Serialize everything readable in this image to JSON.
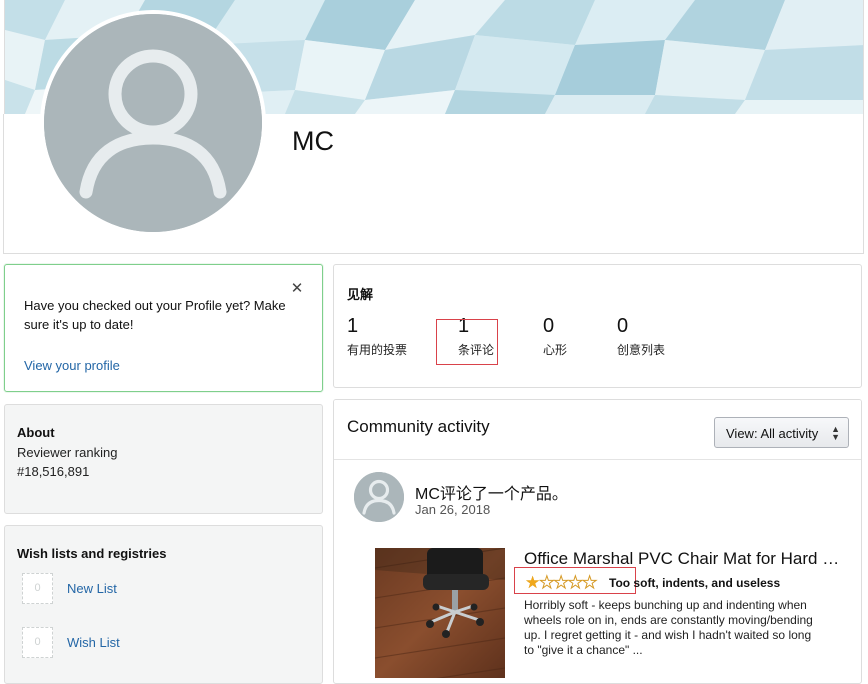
{
  "profile": {
    "name": "MC"
  },
  "notice": {
    "text": "Have you checked out your Profile yet? Make sure it's up to date!",
    "close_glyph": "✕",
    "link": "View your profile"
  },
  "about": {
    "title": "About",
    "ranking_label": "Reviewer ranking",
    "ranking_value": "#18,516,891"
  },
  "wishlists": {
    "title": "Wish lists and registries",
    "items": [
      {
        "thumb_count": "0",
        "label": "New List"
      },
      {
        "thumb_count": "0",
        "label": "Wish List"
      }
    ]
  },
  "insights": {
    "title": "见解",
    "stats": [
      {
        "value": "1",
        "label": "有用的投票"
      },
      {
        "value": "1",
        "label": "条评论"
      },
      {
        "value": "0",
        "label": "心形"
      },
      {
        "value": "0",
        "label": "创意列表"
      }
    ]
  },
  "activity": {
    "title": "Community activity",
    "view_label": "View:  All activity",
    "view_arrows": "▲▼",
    "entry": {
      "headline": "MC评论了一个产品。",
      "date": "Jan 26, 2018",
      "product_title": "Office Marshal PVC Chair Mat for Hard Floors",
      "rating": 1,
      "rating_max": 5,
      "review_title": "Too soft, indents, and useless",
      "review_body": "Horribly soft - keeps bunching up and indenting when wheels role on in, ends are constantly moving/bending up. I regret getting it - and wish I hadn't waited so long to \"give it a chance\" ..."
    }
  },
  "colors": {
    "link": "#2366a6",
    "star": "#f0a81c",
    "highlight": "#d9424a",
    "notice_border": "#7fcf8c"
  }
}
